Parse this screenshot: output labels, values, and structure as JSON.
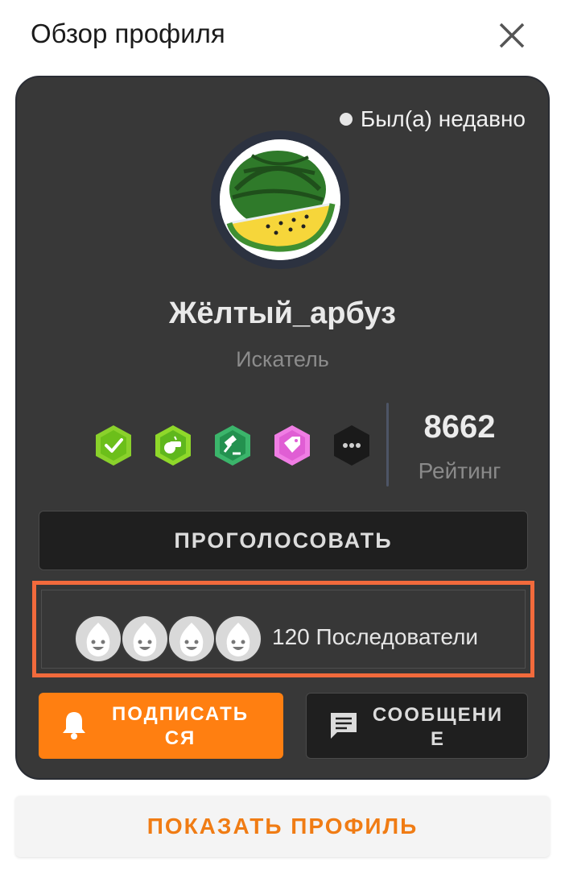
{
  "header": {
    "title": "Обзор профиля"
  },
  "profile": {
    "status": "Был(а) недавно",
    "username": "Жёлтый_арбуз",
    "role": "Искатель",
    "rating_value": "8662",
    "rating_label": "Рейтинг",
    "badges": [
      "check-badge-icon",
      "whistle-badge-icon",
      "gavel-badge-icon",
      "tag-badge-icon",
      "more-badges-icon"
    ]
  },
  "actions": {
    "vote": "ПРОГОЛОСОВАТЬ",
    "subscribe": "ПОДПИСАТЬСЯ",
    "message": "СООБЩЕНИЕ",
    "show_profile": "ПОКАЗАТЬ ПРОФИЛЬ"
  },
  "followers": {
    "text": "120 Последователи"
  },
  "colors": {
    "card_bg": "#383838",
    "accent_orange": "#ff7f11",
    "highlight_border": "#f26a3c",
    "show_profile_text": "#f07c14"
  }
}
